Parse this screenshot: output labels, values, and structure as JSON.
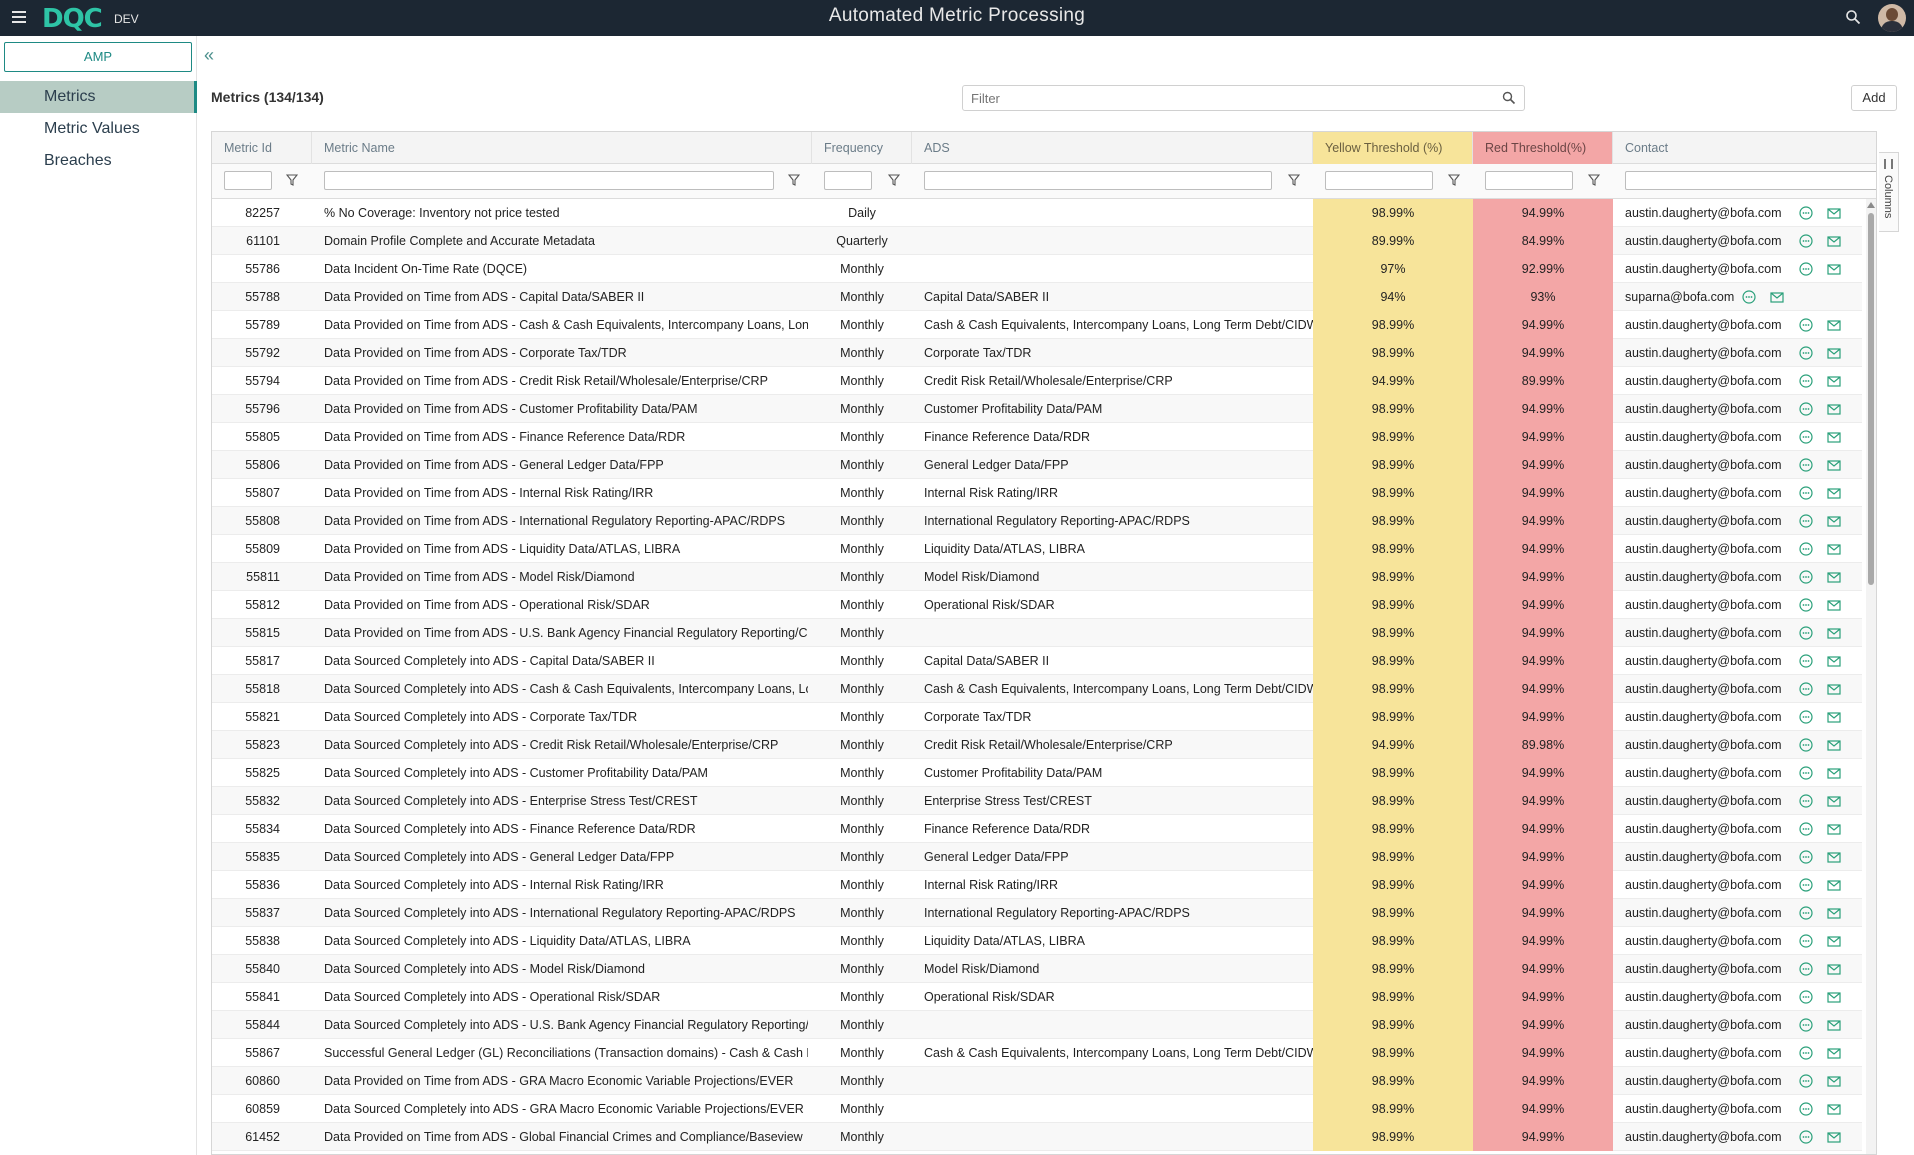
{
  "app": {
    "logo": "DQC",
    "env": "DEV",
    "title": "Automated Metric Processing"
  },
  "sidebar": {
    "app_button": "AMP",
    "items": [
      {
        "label": "Metrics"
      },
      {
        "label": "Metric Values"
      },
      {
        "label": "Breaches"
      }
    ]
  },
  "main": {
    "title": "Metrics (134/134)",
    "filter_placeholder": "Filter",
    "add_label": "Add",
    "columns_tab": "Columns"
  },
  "colors": {
    "topbar": "#1c2733",
    "accent": "#1e8a84",
    "yellow_threshold": "#f7e49a",
    "red_threshold": "#f3a6a6"
  },
  "table": {
    "columns": [
      "Metric Id",
      "Metric Name",
      "Frequency",
      "ADS",
      "Yellow Threshold (%)",
      "Red Threshold(%)",
      "Contact"
    ],
    "rows": [
      [
        "82257",
        "% No Coverage: Inventory not price tested",
        "Daily",
        "",
        "98.99%",
        "94.99%",
        "austin.daugherty@bofa.com"
      ],
      [
        "61101",
        "Domain Profile Complete and Accurate Metadata",
        "Quarterly",
        "",
        "89.99%",
        "84.99%",
        "austin.daugherty@bofa.com"
      ],
      [
        "55786",
        "Data Incident On-Time Rate (DQCE)",
        "Monthly",
        "",
        "97%",
        "92.99%",
        "austin.daugherty@bofa.com"
      ],
      [
        "55788",
        "Data Provided on Time from ADS - Capital Data/SABER II",
        "Monthly",
        "Capital Data/SABER II",
        "94%",
        "93%",
        "suparna@bofa.com"
      ],
      [
        "55789",
        "Data Provided on Time from ADS - Cash & Cash Equivalents, Intercompany Loans, Long T",
        "Monthly",
        "Cash & Cash Equivalents, Intercompany Loans, Long Term Debt/CIDW",
        "98.99%",
        "94.99%",
        "austin.daugherty@bofa.com"
      ],
      [
        "55792",
        "Data Provided on Time from ADS - Corporate Tax/TDR",
        "Monthly",
        "Corporate Tax/TDR",
        "98.99%",
        "94.99%",
        "austin.daugherty@bofa.com"
      ],
      [
        "55794",
        "Data Provided on Time from ADS - Credit Risk Retail/Wholesale/Enterprise/CRP",
        "Monthly",
        "Credit Risk Retail/Wholesale/Enterprise/CRP",
        "94.99%",
        "89.99%",
        "austin.daugherty@bofa.com"
      ],
      [
        "55796",
        "Data Provided on Time from ADS - Customer Profitability Data/PAM",
        "Monthly",
        "Customer Profitability Data/PAM",
        "98.99%",
        "94.99%",
        "austin.daugherty@bofa.com"
      ],
      [
        "55805",
        "Data Provided on Time from ADS - Finance Reference Data/RDR",
        "Monthly",
        "Finance Reference Data/RDR",
        "98.99%",
        "94.99%",
        "austin.daugherty@bofa.com"
      ],
      [
        "55806",
        "Data Provided on Time from ADS - General Ledger Data/FPP",
        "Monthly",
        "General Ledger Data/FPP",
        "98.99%",
        "94.99%",
        "austin.daugherty@bofa.com"
      ],
      [
        "55807",
        "Data Provided on Time from ADS - Internal Risk Rating/IRR",
        "Monthly",
        "Internal Risk Rating/IRR",
        "98.99%",
        "94.99%",
        "austin.daugherty@bofa.com"
      ],
      [
        "55808",
        "Data Provided on Time from ADS - International Regulatory Reporting-APAC/RDPS",
        "Monthly",
        "International Regulatory Reporting-APAC/RDPS",
        "98.99%",
        "94.99%",
        "austin.daugherty@bofa.com"
      ],
      [
        "55809",
        "Data Provided on Time from ADS - Liquidity Data/ATLAS, LIBRA",
        "Monthly",
        "Liquidity Data/ATLAS, LIBRA",
        "98.99%",
        "94.99%",
        "austin.daugherty@bofa.com"
      ],
      [
        "55811",
        "Data Provided on Time from ADS - Model Risk/Diamond",
        "Monthly",
        "Model Risk/Diamond",
        "98.99%",
        "94.99%",
        "austin.daugherty@bofa.com"
      ],
      [
        "55812",
        "Data Provided on Time from ADS - Operational Risk/SDAR",
        "Monthly",
        "Operational Risk/SDAR",
        "98.99%",
        "94.99%",
        "austin.daugherty@bofa.com"
      ],
      [
        "55815",
        "Data Provided on Time from ADS - U.S. Bank Agency Financial Regulatory Reporting/CFAR",
        "Monthly",
        "",
        "98.99%",
        "94.99%",
        "austin.daugherty@bofa.com"
      ],
      [
        "55817",
        "Data Sourced Completely into ADS - Capital Data/SABER II",
        "Monthly",
        "Capital Data/SABER II",
        "98.99%",
        "94.99%",
        "austin.daugherty@bofa.com"
      ],
      [
        "55818",
        "Data Sourced Completely into ADS - Cash & Cash Equivalents, Intercompany Loans, Long",
        "Monthly",
        "Cash & Cash Equivalents, Intercompany Loans, Long Term Debt/CIDW",
        "98.99%",
        "94.99%",
        "austin.daugherty@bofa.com"
      ],
      [
        "55821",
        "Data Sourced Completely into ADS - Corporate Tax/TDR",
        "Monthly",
        "Corporate Tax/TDR",
        "98.99%",
        "94.99%",
        "austin.daugherty@bofa.com"
      ],
      [
        "55823",
        "Data Sourced Completely into ADS - Credit Risk Retail/Wholesale/Enterprise/CRP",
        "Monthly",
        "Credit Risk Retail/Wholesale/Enterprise/CRP",
        "94.99%",
        "89.98%",
        "austin.daugherty@bofa.com"
      ],
      [
        "55825",
        "Data Sourced Completely into ADS - Customer Profitability Data/PAM",
        "Monthly",
        "Customer Profitability Data/PAM",
        "98.99%",
        "94.99%",
        "austin.daugherty@bofa.com"
      ],
      [
        "55832",
        "Data Sourced Completely into ADS - Enterprise Stress Test/CREST",
        "Monthly",
        "Enterprise Stress Test/CREST",
        "98.99%",
        "94.99%",
        "austin.daugherty@bofa.com"
      ],
      [
        "55834",
        "Data Sourced Completely into ADS - Finance Reference Data/RDR",
        "Monthly",
        "Finance Reference Data/RDR",
        "98.99%",
        "94.99%",
        "austin.daugherty@bofa.com"
      ],
      [
        "55835",
        "Data Sourced Completely into ADS - General Ledger Data/FPP",
        "Monthly",
        "General Ledger Data/FPP",
        "98.99%",
        "94.99%",
        "austin.daugherty@bofa.com"
      ],
      [
        "55836",
        "Data Sourced Completely into ADS - Internal Risk Rating/IRR",
        "Monthly",
        "Internal Risk Rating/IRR",
        "98.99%",
        "94.99%",
        "austin.daugherty@bofa.com"
      ],
      [
        "55837",
        "Data Sourced Completely into ADS - International Regulatory Reporting-APAC/RDPS",
        "Monthly",
        "International Regulatory Reporting-APAC/RDPS",
        "98.99%",
        "94.99%",
        "austin.daugherty@bofa.com"
      ],
      [
        "55838",
        "Data Sourced Completely into ADS - Liquidity Data/ATLAS, LIBRA",
        "Monthly",
        "Liquidity Data/ATLAS, LIBRA",
        "98.99%",
        "94.99%",
        "austin.daugherty@bofa.com"
      ],
      [
        "55840",
        "Data Sourced Completely into ADS - Model Risk/Diamond",
        "Monthly",
        "Model Risk/Diamond",
        "98.99%",
        "94.99%",
        "austin.daugherty@bofa.com"
      ],
      [
        "55841",
        "Data Sourced Completely into ADS - Operational Risk/SDAR",
        "Monthly",
        "Operational Risk/SDAR",
        "98.99%",
        "94.99%",
        "austin.daugherty@bofa.com"
      ],
      [
        "55844",
        "Data Sourced Completely into ADS - U.S. Bank Agency Financial Regulatory Reporting/CF",
        "Monthly",
        "",
        "98.99%",
        "94.99%",
        "austin.daugherty@bofa.com"
      ],
      [
        "55867",
        "Successful General Ledger (GL) Reconciliations (Transaction domains) - Cash & Cash Equiv",
        "Monthly",
        "Cash & Cash Equivalents, Intercompany Loans, Long Term Debt/CIDW",
        "98.99%",
        "94.99%",
        "austin.daugherty@bofa.com"
      ],
      [
        "60860",
        "Data Provided on Time from ADS - GRA Macro Economic Variable Projections/EVER",
        "Monthly",
        "",
        "98.99%",
        "94.99%",
        "austin.daugherty@bofa.com"
      ],
      [
        "60859",
        "Data Sourced Completely into ADS - GRA Macro Economic Variable Projections/EVER",
        "Monthly",
        "",
        "98.99%",
        "94.99%",
        "austin.daugherty@bofa.com"
      ],
      [
        "61452",
        "Data Provided on Time from ADS - Global Financial Crimes and Compliance/Baseview",
        "Monthly",
        "",
        "98.99%",
        "94.99%",
        "austin.daugherty@bofa.com"
      ]
    ]
  }
}
